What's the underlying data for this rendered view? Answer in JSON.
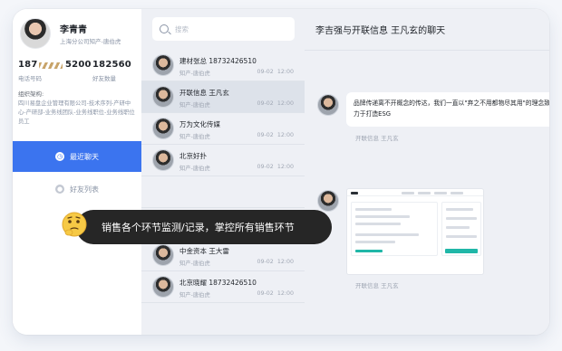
{
  "profile": {
    "name": "李青青",
    "subtitle": "上海分公司知产-唐伯虎",
    "stat1_prefix": "187",
    "stat1_value": "5200",
    "stat1_label": "电话号码",
    "stat2_value": "182560",
    "stat2_label": "好友数量",
    "org_title": "组织架构:",
    "org_text": "四川易盘企业管理有限公司-技术序列-产研中心-产研部-业务线团队-业务线职位-业务线职位员工"
  },
  "nav": {
    "recent_chats": "最近聊天",
    "friends_list": "好友列表"
  },
  "search": {
    "placeholder": "搜索"
  },
  "conversations": [
    {
      "name": "建材张总 18732426510",
      "sub": "知产-唐伯虎",
      "date": "09-02",
      "time": "12:00"
    },
    {
      "name": "开联信息 王凡玄",
      "sub": "知产-唐伯虎",
      "date": "09-02",
      "time": "12:00"
    },
    {
      "name": "万为文化传媒",
      "sub": "知产-唐伯虎",
      "date": "09-02",
      "time": "12:00"
    },
    {
      "name": "北京好扑",
      "sub": "知产-唐伯虎",
      "date": "09-02",
      "time": "12:00"
    },
    {
      "name": "",
      "sub": "",
      "date": "",
      "time": ""
    },
    {
      "name": "",
      "sub": "",
      "date": "",
      "time": ""
    },
    {
      "name": "中金资本 王大雷",
      "sub": "知产-唐伯虎",
      "date": "09-02",
      "time": "12:00"
    },
    {
      "name": "北京晓耀 18732426510",
      "sub": "知产-唐伯虎",
      "date": "09-02",
      "time": "12:00"
    }
  ],
  "chat": {
    "title": "李吉强与开联信息 王凡玄的聊天",
    "message1_line1": "品牌传递离不开概念的传达，我们一直以\"弃之不用都物尽其用\"的理念致",
    "message1_line2": "力于打造ESG",
    "sender1": "开联信息 王凡玄",
    "sender2": "开联信息 王凡玄"
  },
  "caption": {
    "text": "销售各个环节监测/记录，掌控所有销售环节"
  },
  "colors": {
    "accent": "#3b74ef",
    "list_bg": "#eef0f5",
    "caption_bg": "#262626"
  }
}
